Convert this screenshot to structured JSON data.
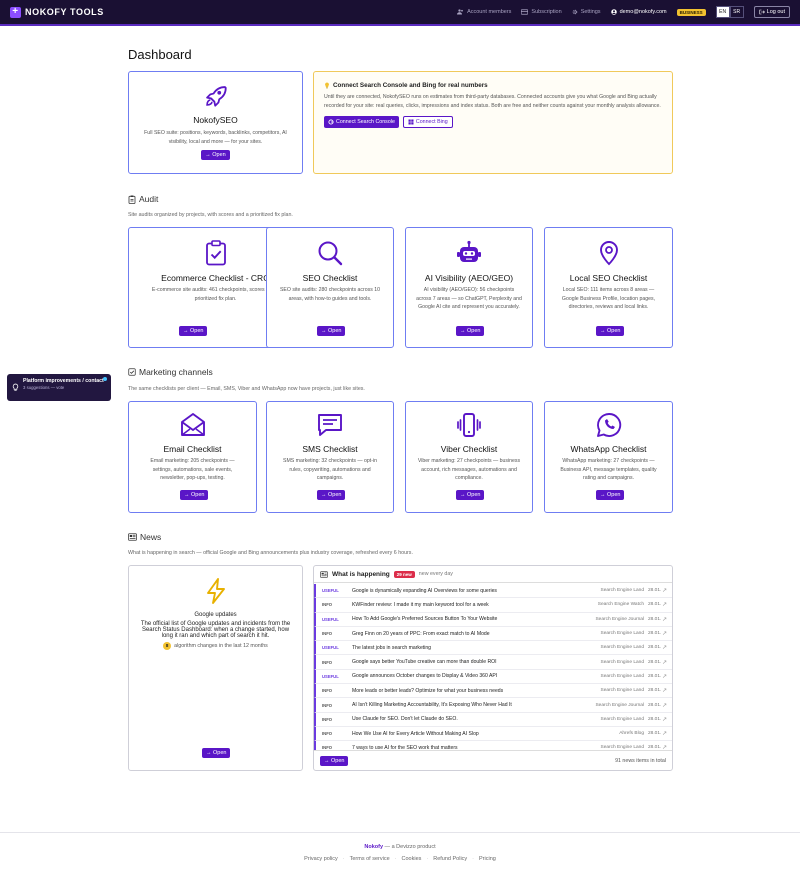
{
  "topbar": {
    "brand": "NOKOFY TOOLS",
    "nav": [
      {
        "label": "Account members",
        "icon": "people-icon"
      },
      {
        "label": "Subscription",
        "icon": "card-icon"
      },
      {
        "label": "Settings",
        "icon": "gear-icon"
      }
    ],
    "user_email": "demo@nokofy.com",
    "plan_badge": "BUSINESS",
    "lang_en": "EN",
    "lang_sr": "SR",
    "logout": "Log out"
  },
  "page_title": "Dashboard",
  "nokofyseo": {
    "title": "NokofySEO",
    "desc": "Full SEO suite: positions, keywords, backlinks, competitors, AI visibility, local and more — for your sites.",
    "open": "→ Open"
  },
  "connect": {
    "title": "Connect Search Console and Bing for real numbers",
    "text": "Until they are connected, NokofySEO runs on estimates from third-party databases. Connected accounts give you what Google and Bing actually recorded for your site: real queries, clicks, impressions and index status. Both are free and neither counts against your monthly analysis allowance.",
    "btn_gsc": "Connect Search Console",
    "btn_bing": "Connect Bing"
  },
  "audit": {
    "title": "Audit",
    "desc": "Site audits organized by projects, with scores and a prioritized fix plan.",
    "cards": [
      {
        "title": "Ecommerce Checklist - CRO",
        "desc": "E-commerce site audits: 461 checkpoints, scores and a prioritized fix plan.",
        "open": "→ Open"
      },
      {
        "title": "SEO Checklist",
        "desc": "SEO site audits: 280 checkpoints across 10 areas, with how-to guides and tools.",
        "open": "→ Open"
      },
      {
        "title": "AI Visibility (AEO/GEO)",
        "desc": "AI visibility (AEO/GEO): 56 checkpoints across 7 areas — so ChatGPT, Perplexity and Google AI cite and represent you accurately.",
        "open": "→ Open"
      },
      {
        "title": "Local SEO Checklist",
        "desc": "Local SEO: 111 items across 8 areas — Google Business Profile, location pages, directories, reviews and local links.",
        "open": "→ Open"
      }
    ]
  },
  "marketing": {
    "title": "Marketing channels",
    "desc": "The same checklists per client — Email, SMS, Viber and WhatsApp now have projects, just like sites.",
    "cards": [
      {
        "title": "Email Checklist",
        "desc": "Email marketing: 205 checkpoints — settings, automations, sale events, newsletter, pop-ups, testing.",
        "open": "→ Open"
      },
      {
        "title": "SMS Checklist",
        "desc": "SMS marketing: 32 checkpoints — opt-in rules, copywriting, automations and campaigns.",
        "open": "→ Open"
      },
      {
        "title": "Viber Checklist",
        "desc": "Viber marketing: 27 checkpoints — business account, rich messages, automations and compliance.",
        "open": "→ Open"
      },
      {
        "title": "WhatsApp Checklist",
        "desc": "WhatsApp marketing: 27 checkpoints — Business API, message templates, quality rating and campaigns.",
        "open": "→ Open"
      }
    ]
  },
  "widget": {
    "title": "Platform improvements / contact",
    "sub": "3 suggestions — vote"
  },
  "news_section": {
    "title": "News",
    "desc": "What is happening in search — official Google and Bing announcements plus industry coverage, refreshed every 6 hours."
  },
  "google_updates": {
    "title": "Google updates",
    "desc": "The official list of Google updates and incidents from the Search Status Dashboard: when a change started, how long it ran and which part of search it hit.",
    "count": "8",
    "count_text": "algorithm changes in the last 12 months",
    "open": "→ Open"
  },
  "news": {
    "title": "What is happening",
    "badge": "29 new",
    "sub": "new every day",
    "rows": [
      {
        "tag": "USEFUL",
        "title": "Google is dynamically expanding AI Overviews for some queries",
        "source": "Search Engine Land",
        "date": "28.01."
      },
      {
        "tag": "INFO",
        "title": "KWFinder review: I made it my main keyword tool for a week",
        "source": "Search Engine Watch",
        "date": "28.01."
      },
      {
        "tag": "USEFUL",
        "title": "How To Add Google's Preferred Sources Button To Your Website",
        "source": "Search Engine Journal",
        "date": "28.01."
      },
      {
        "tag": "INFO",
        "title": "Greg Finn on 20 years of PPC: From exact match to AI Mode",
        "source": "Search Engine Land",
        "date": "28.01."
      },
      {
        "tag": "USEFUL",
        "title": "The latest jobs in search marketing",
        "source": "Search Engine Land",
        "date": "28.01."
      },
      {
        "tag": "INFO",
        "title": "Google says better YouTube creative can more than double ROI",
        "source": "Search Engine Land",
        "date": "28.01."
      },
      {
        "tag": "USEFUL",
        "title": "Google announces October changes to Display & Video 360 API",
        "source": "Search Engine Land",
        "date": "28.01."
      },
      {
        "tag": "INFO",
        "title": "More leads or better leads? Optimize for what your business needs",
        "source": "Search Engine Land",
        "date": "28.01."
      },
      {
        "tag": "INFO",
        "title": "AI Isn't Killing Marketing Accountability, It's Exposing Who Never Had It",
        "source": "Search Engine Journal",
        "date": "28.01."
      },
      {
        "tag": "INFO",
        "title": "Use Claude for SEO. Don't let Claude do SEO.",
        "source": "Search Engine Land",
        "date": "28.01."
      },
      {
        "tag": "INFO",
        "title": "How We Use AI for Every Article Without Making AI Slop",
        "source": "Ahrefs Blog",
        "date": "28.01."
      },
      {
        "tag": "INFO",
        "title": "7 ways to use AI for the SEO work that matters",
        "source": "Search Engine Land",
        "date": "28.01."
      }
    ],
    "open": "→ Open",
    "count": "91 news items in total"
  },
  "footer": {
    "brand": "Nokofy",
    "rest": "— a Devizzo product",
    "links": [
      "Privacy policy",
      "Terms of service",
      "Cookies",
      "Refund Policy",
      "Pricing"
    ]
  },
  "colors": {
    "accent": "#5a16c7",
    "card_border": "#6f7df2",
    "topbar": "#1a1033",
    "highlight": "#f0c95a"
  }
}
